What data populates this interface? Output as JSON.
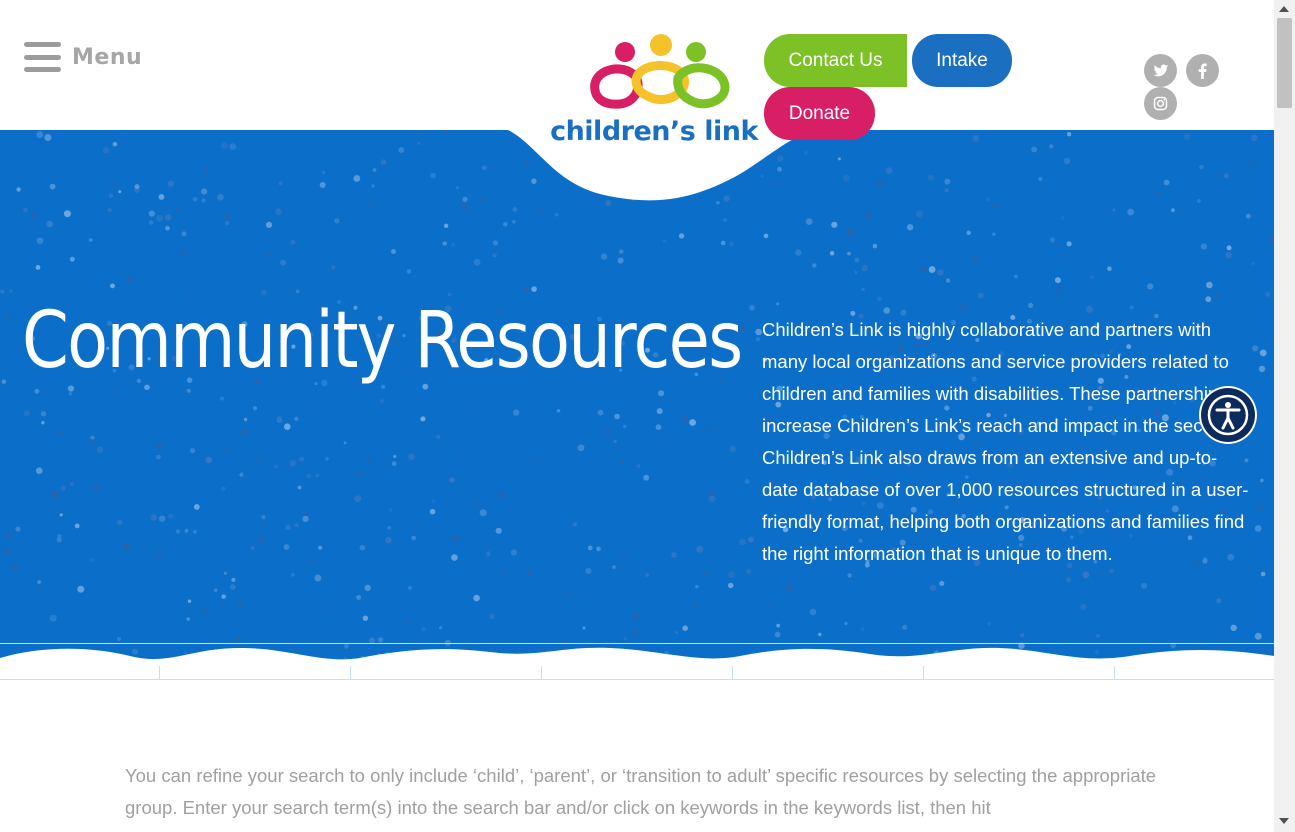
{
  "header": {
    "menu_label": "Menu",
    "logo_text": "children’s link",
    "buttons": {
      "contact": "Contact Us",
      "intake": "Intake",
      "donate": "Donate"
    },
    "social": [
      "twitter-icon",
      "facebook-icon",
      "instagram-icon"
    ]
  },
  "hero": {
    "title": "Community Resources",
    "description": "Children’s Link is highly collaborative and partners with many local organizations and service providers related to children and families with disabilities. These partnerships increase Children’s Link’s reach and impact in the sector. Children’s Link also draws from an extensive and up-to-date database of over 1,000 resources structured in a user-friendly format, helping both organizations and families find the right information that is unique to them."
  },
  "intro": {
    "text": "You can refine your search to only include ‘child’, ‘parent’, or ‘transition to adult’ specific resources by selecting the appropriate group. Enter your search term(s) into the search bar and/or click on keywords in the keywords list, then hit"
  },
  "colors": {
    "brand_blue": "#0b6fc9",
    "green": "#7cc125",
    "pink": "#d81f66",
    "yellow": "#f6c22c",
    "gray": "#b0b0b0"
  },
  "accessibility_icon": "accessibility-icon"
}
